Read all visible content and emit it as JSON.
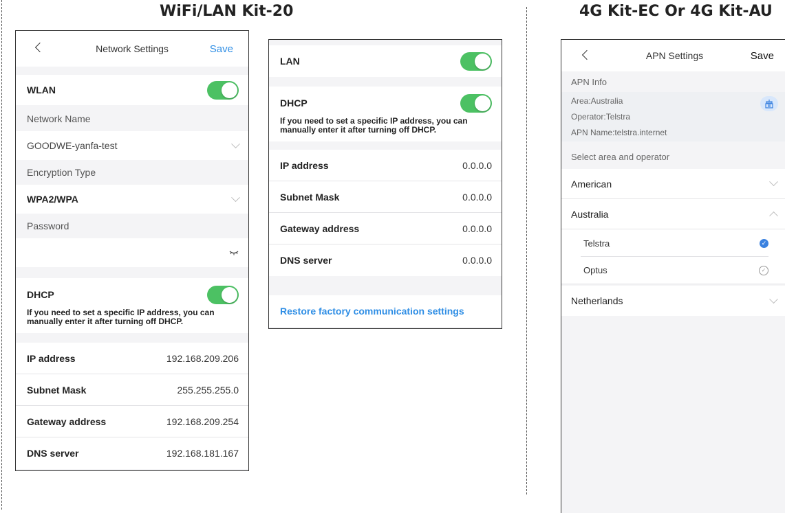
{
  "headings": {
    "left": "WiFi/LAN Kit-20",
    "right": "4G Kit-EC Or 4G Kit-AU"
  },
  "network_settings": {
    "title": "Network Settings",
    "save_label": "Save",
    "wlan_label": "WLAN",
    "wlan_on": true,
    "network_name_label": "Network Name",
    "network_name_value": "GOODWE-yanfa-test",
    "encryption_label": "Encryption Type",
    "encryption_value": "WPA2/WPA",
    "password_label": "Password",
    "dhcp_label": "DHCP",
    "dhcp_on": true,
    "dhcp_hint_line1": "If you need to set a specific IP address, you can",
    "dhcp_hint_line2": "manually enter it after turning off DHCP.",
    "fields": [
      {
        "label": "IP address",
        "value": "192.168.209.206"
      },
      {
        "label": "Subnet Mask",
        "value": "255.255.255.0"
      },
      {
        "label": "Gateway address",
        "value": "192.168.209.254"
      },
      {
        "label": "DNS server",
        "value": "192.168.181.167"
      }
    ]
  },
  "lan_settings": {
    "lan_label": "LAN",
    "lan_on": true,
    "dhcp_label": "DHCP",
    "dhcp_on": true,
    "dhcp_hint_line1": "If you need to set a specific IP address, you can",
    "dhcp_hint_line2": "manually enter it after turning off DHCP.",
    "fields": [
      {
        "label": "IP address",
        "value": "0.0.0.0"
      },
      {
        "label": "Subnet Mask",
        "value": "0.0.0.0"
      },
      {
        "label": "Gateway address",
        "value": "0.0.0.0"
      },
      {
        "label": "DNS server",
        "value": "0.0.0.0"
      }
    ],
    "restore_link": "Restore factory communication settings"
  },
  "apn_settings": {
    "title": "APN Settings",
    "save_label": "Save",
    "info_header": "APN Info",
    "area": "Area:Australia",
    "operator": "Operator:Telstra",
    "apn_name": "APN Name:telstra.internet",
    "select_header": "Select area and operator",
    "areas": [
      {
        "label": "American"
      },
      {
        "label": "Australia"
      },
      {
        "label": "Netherlands"
      }
    ],
    "operators": [
      {
        "label": "Telstra",
        "selected": true
      },
      {
        "label": "Optus",
        "selected": false
      }
    ]
  },
  "colors": {
    "toggle_on": "#4cc163",
    "link_blue": "#2f8ee5",
    "check_blue": "#3b82e0"
  },
  "icons": [
    "back-chevron-icon",
    "chevron-down-icon",
    "chevron-up-icon",
    "eye-closed-icon",
    "tower-icon",
    "check-circle-icon"
  ]
}
